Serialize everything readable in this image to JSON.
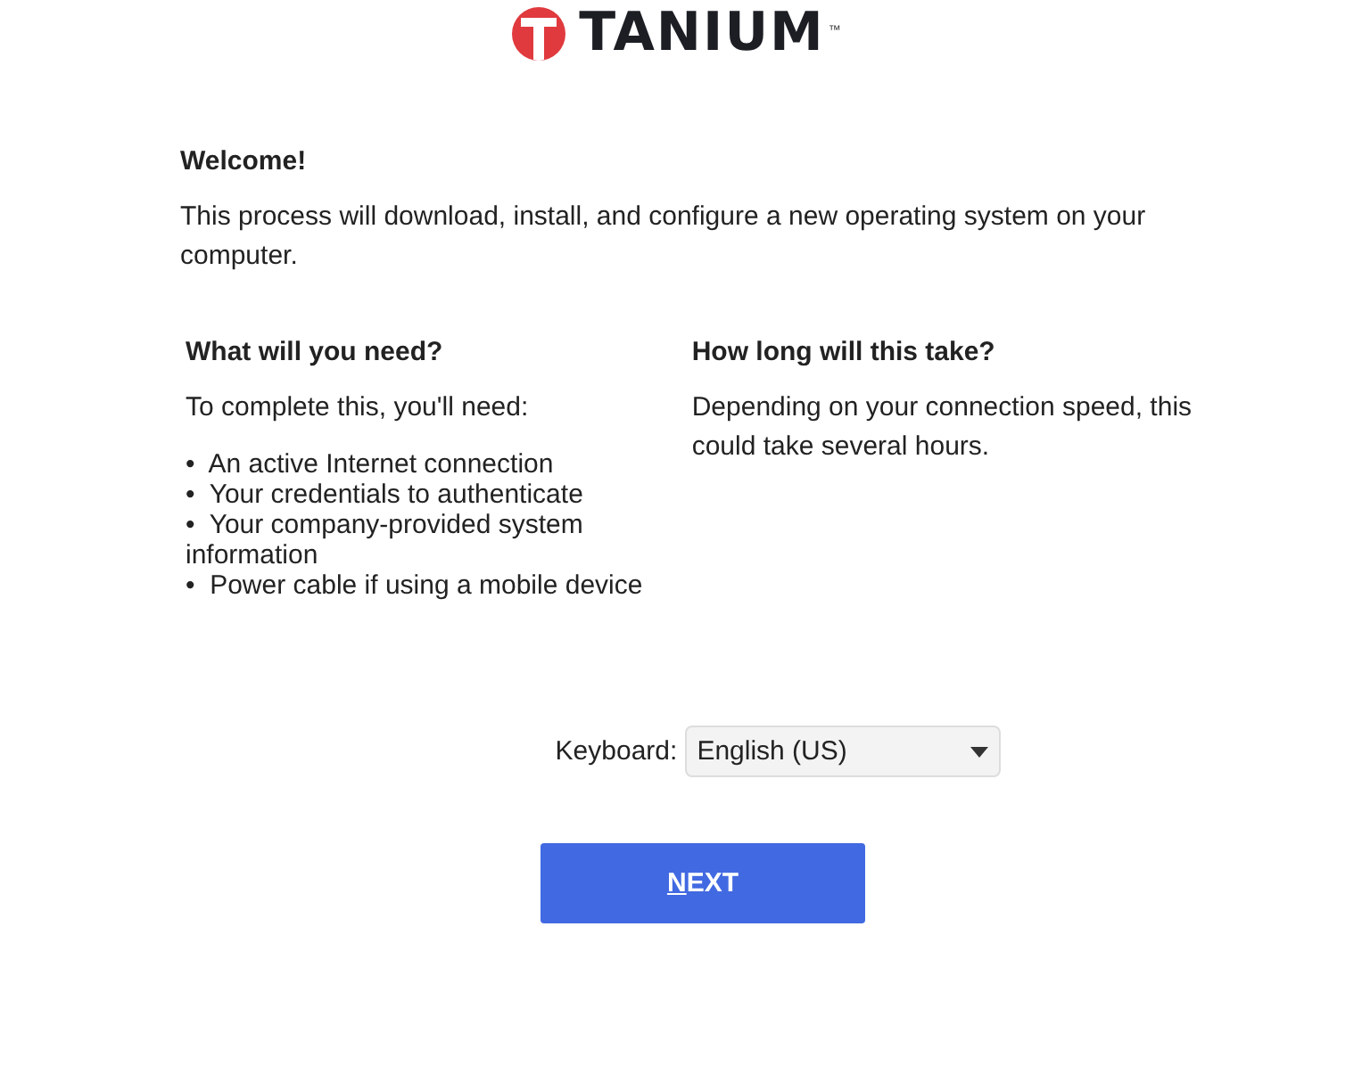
{
  "logo": {
    "text": "TANIUM",
    "trademark": "™"
  },
  "welcome": {
    "title": "Welcome!",
    "text": "This process will download, install, and configure a new operating system on your computer."
  },
  "need": {
    "title": "What will you need?",
    "intro": "To complete this, you'll need:",
    "bullet": "•",
    "items": [
      "An active Internet connection",
      "Your credentials to authenticate",
      "Your company-provided system information",
      "Power cable if using a mobile device"
    ]
  },
  "duration": {
    "title": "How long will this take?",
    "text": "Depending on your connection speed, this could take several hours."
  },
  "keyboard": {
    "label": "Keyboard:",
    "value": "English (US)"
  },
  "next_button": {
    "access_key": "N",
    "rest": "EXT"
  }
}
